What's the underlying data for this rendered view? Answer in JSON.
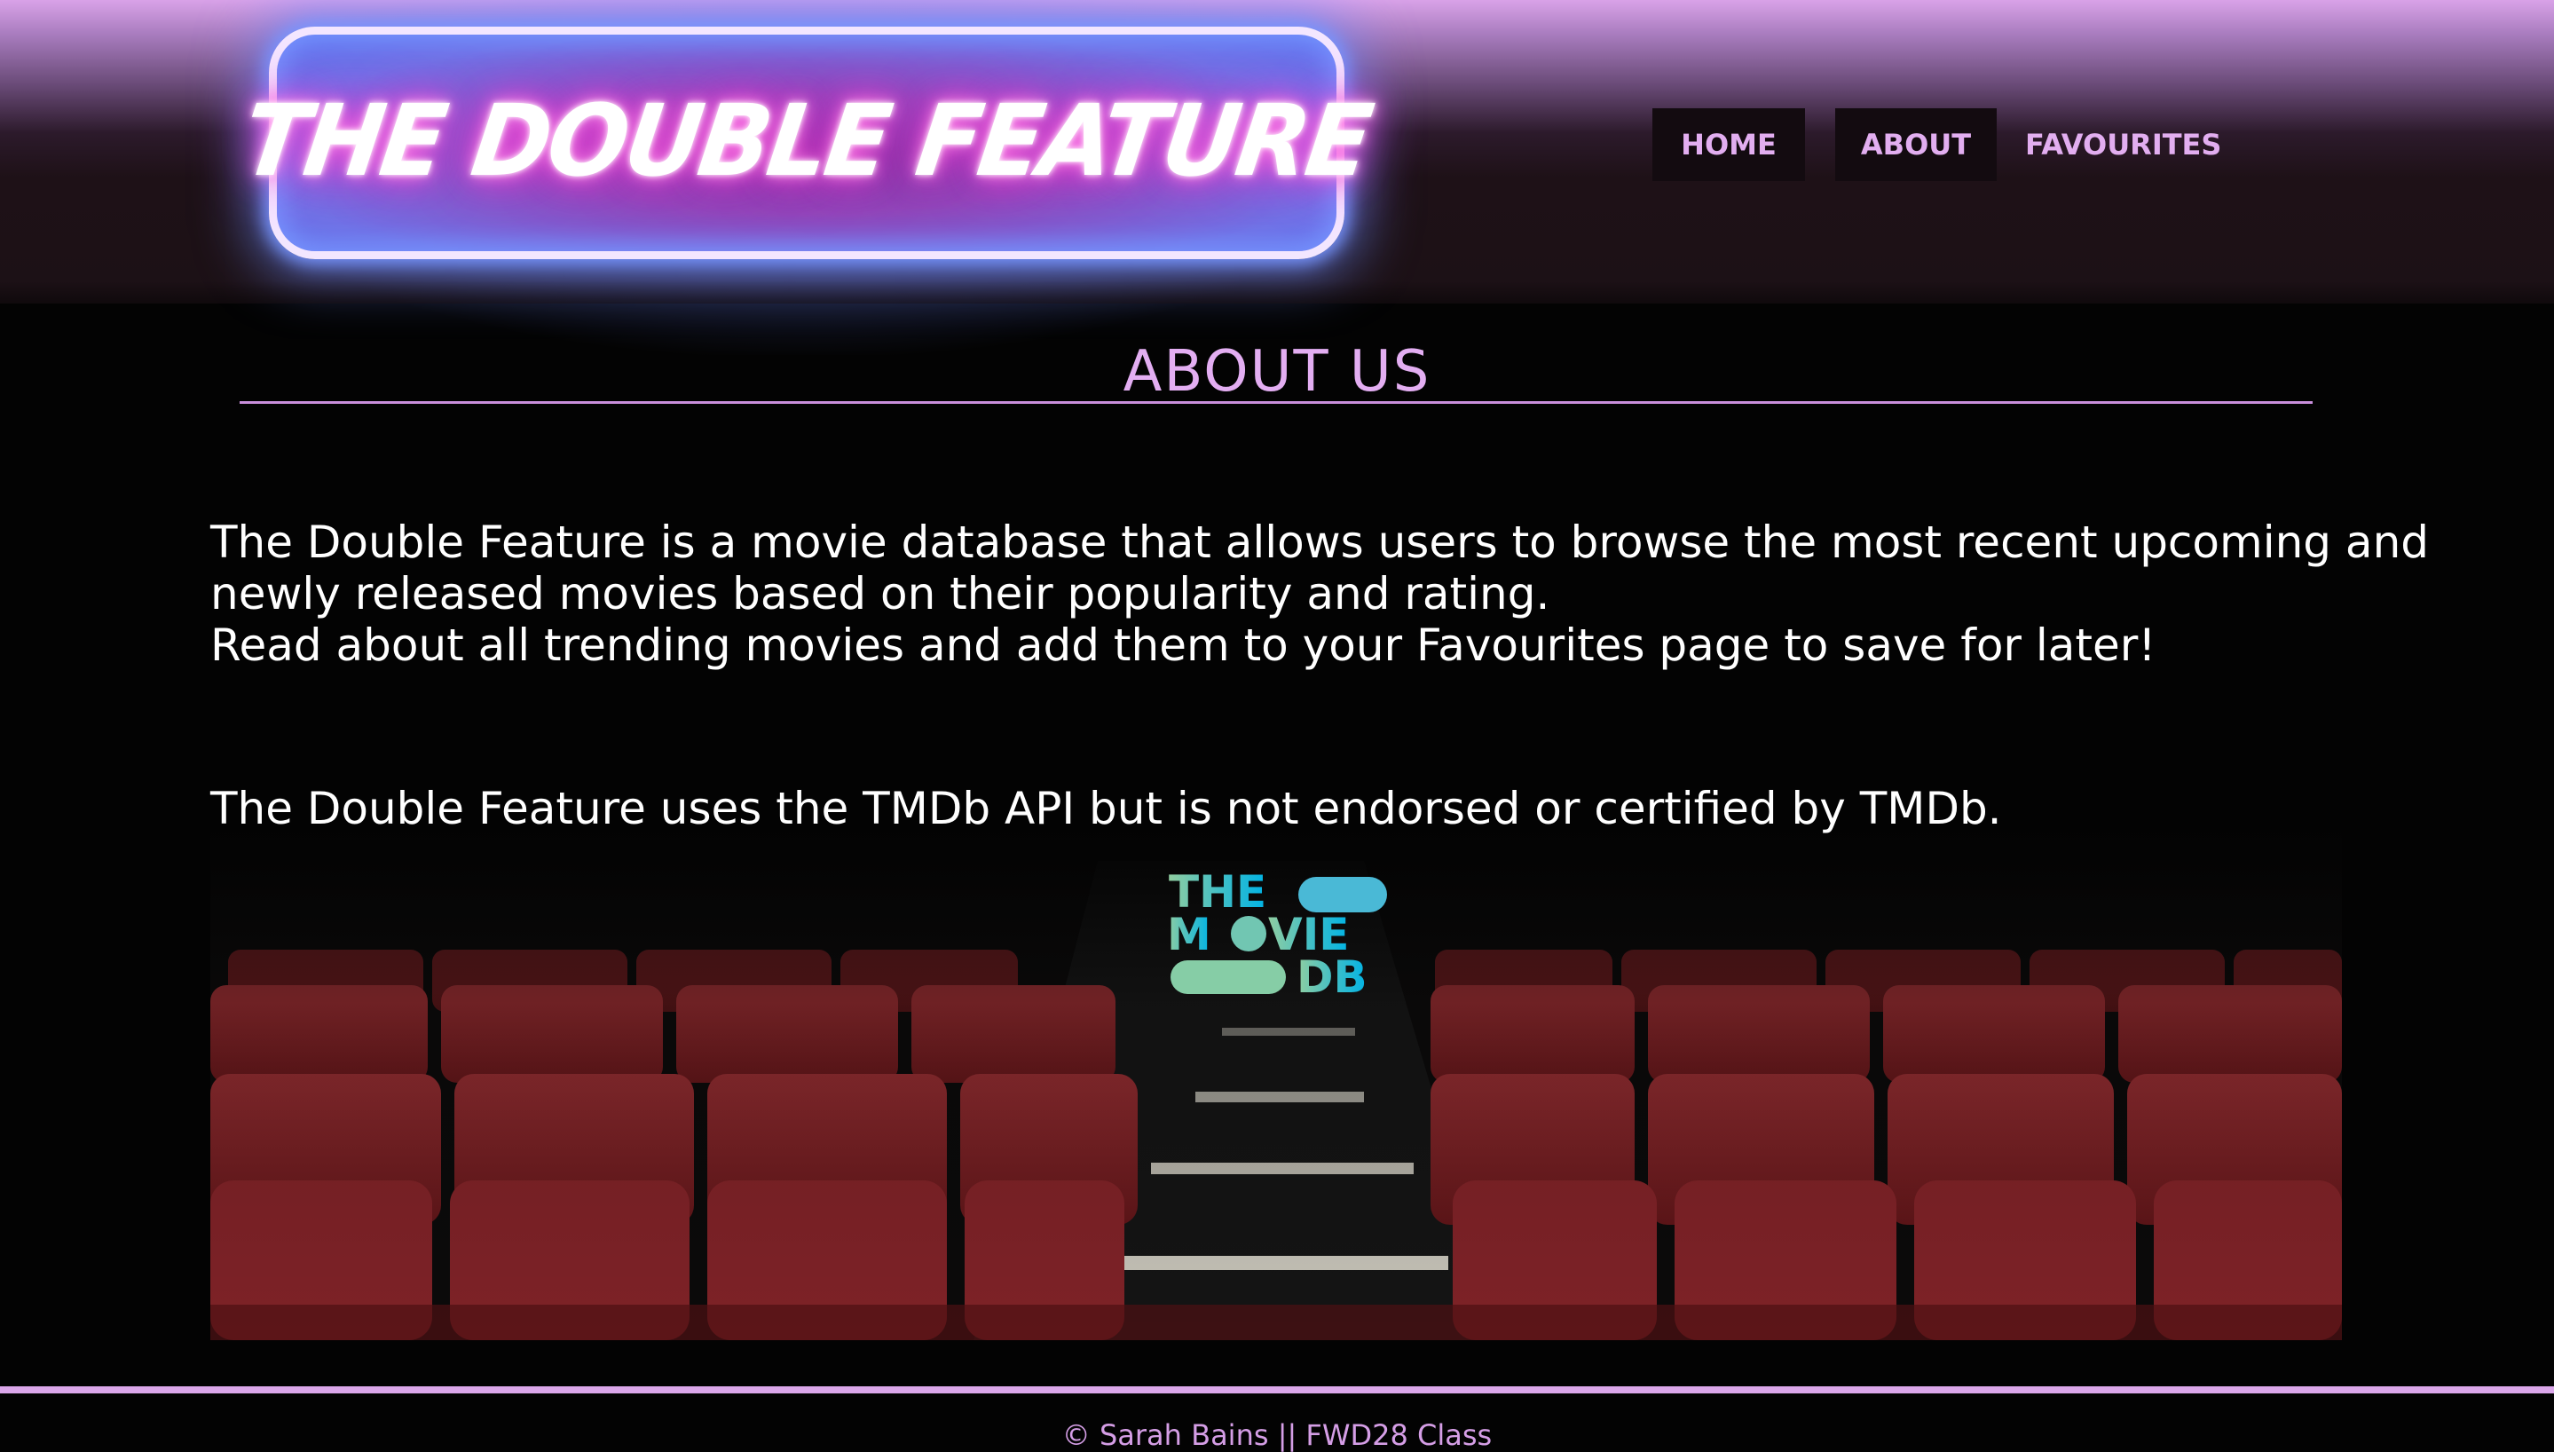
{
  "header": {
    "logo_text": "THE DOUBLE FEATURE"
  },
  "nav": {
    "home": "HOME",
    "about": "ABOUT",
    "favourites": "FAVOURITES"
  },
  "main": {
    "title": "ABOUT US",
    "paragraph_1": "The Double Feature is a movie database that allows users to browse the most recent upcoming and newly released movies based on their popularity and rating.",
    "paragraph_2": "Read about all trending movies and add them to your Favourites page to save for later!",
    "paragraph_3": "The Double Feature uses the TMDb API but is not endorsed or certified by TMDb.",
    "tmdb_logo": {
      "line_1": "THE",
      "line_2_a": "M",
      "line_2_b": "VIE",
      "line_3": "DB"
    }
  },
  "footer": {
    "text": "© Sarah Bains || FWD28 Class"
  },
  "colors": {
    "accent": "#e3aef2",
    "seat_red": "#7a1f22",
    "tmdb_green": "#90cea1",
    "tmdb_blue": "#01b4e4"
  }
}
